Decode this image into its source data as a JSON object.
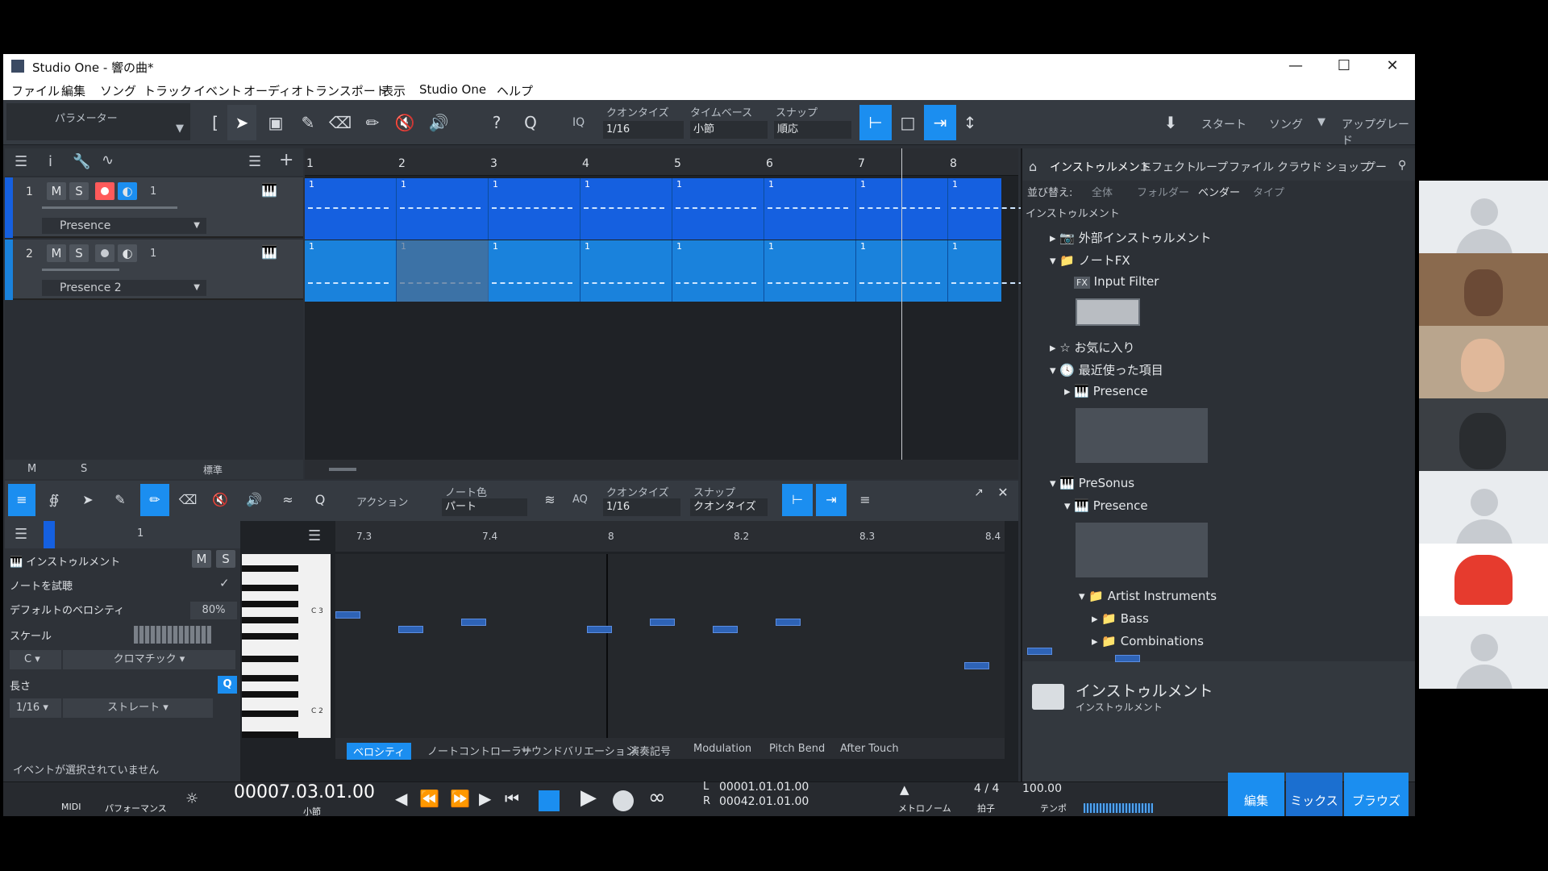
{
  "window": {
    "title": "Studio One - 響の曲*"
  },
  "menu": [
    "ファイル",
    "編集",
    "ソング",
    "トラック",
    "イベント",
    "オーディオ",
    "トランスポート",
    "表示",
    "Studio One",
    "ヘルプ"
  ],
  "toolbar": {
    "param_label": "パラメーター",
    "quantize_label": "クオンタイズ",
    "quantize_value": "1/16",
    "timebase_label": "タイムベース",
    "timebase_value": "小節",
    "snap_label": "スナップ",
    "snap_value": "順応",
    "iq": "IQ",
    "start": "スタート",
    "song": "ソング",
    "upgrade": "アップグレード"
  },
  "tracks": [
    {
      "num": "1",
      "m": "M",
      "s": "S",
      "ch": "1",
      "instrument": "Presence",
      "record_armed": true
    },
    {
      "num": "2",
      "m": "M",
      "s": "S",
      "ch": "1",
      "instrument": "Presence 2",
      "record_armed": false
    }
  ],
  "arrange": {
    "ruler": [
      "1",
      "2",
      "3",
      "4",
      "5",
      "6",
      "7",
      "8"
    ],
    "part_label": "1",
    "footer_m": "M",
    "footer_s": "S",
    "footer_mode": "標準"
  },
  "browser": {
    "tabs": [
      "インストゥルメント",
      "エフェクト",
      "ループ",
      "ファイル",
      "クラウド",
      "ショップ",
      "プー"
    ],
    "sort_label": "並び替え:",
    "sort_options": [
      "全体",
      "フォルダー",
      "ベンダー",
      "タイプ"
    ],
    "breadcrumb": "インストゥルメント",
    "items": [
      {
        "label": "外部インストゥルメント"
      },
      {
        "label": "ノートFX"
      },
      {
        "label": "Input Filter"
      },
      {
        "label": "お気に入り"
      },
      {
        "label": "最近使った項目"
      },
      {
        "label": "Presence"
      },
      {
        "label": "PreSonus"
      },
      {
        "label": "Presence"
      },
      {
        "label": "Artist Instruments"
      },
      {
        "label": "Bass"
      },
      {
        "label": "Combinations"
      }
    ],
    "fx_badge": "FX",
    "footer_title": "インストゥルメント",
    "footer_sub": "インストゥルメント"
  },
  "editor": {
    "action": "アクション",
    "note_color_label": "ノート色",
    "note_color_value": "パート",
    "aq": "AQ",
    "quantize_label": "クオンタイズ",
    "quantize_value": "1/16",
    "snap_label": "スナップ",
    "snap_value": "クオンタイズ",
    "track_num": "1",
    "ruler": [
      "7.3",
      "7.4",
      "8",
      "8.2",
      "8.3",
      "8.4"
    ],
    "rows": {
      "instrument": "インストゥルメント",
      "m": "M",
      "s": "S",
      "audition": "ノートを試聴",
      "velocity_label": "デフォルトのベロシティ",
      "velocity_value": "80%",
      "scale": "スケール",
      "key": "C",
      "scale_type": "クロマチック",
      "length": "長さ",
      "length_value": "1/16",
      "length_type": "ストレート"
    },
    "piano_labels": [
      "C 3",
      "C 2"
    ],
    "bottom_tabs": [
      "ベロシティ",
      "ノートコントローラー",
      "サウンドバリエーション",
      "演奏記号",
      "Modulation",
      "Pitch Bend",
      "After Touch"
    ],
    "status": "イベントが選択されていません",
    "notes": [
      {
        "pitch": 3,
        "start": 7.3,
        "len": 0.02
      },
      {
        "pitch": 5,
        "start": 7.35,
        "len": 0.02
      },
      {
        "pitch": 4,
        "start": 7.4,
        "len": 0.02
      },
      {
        "pitch": 5,
        "start": 8.0,
        "len": 0.02
      },
      {
        "pitch": 4,
        "start": 8.05,
        "len": 0.02
      },
      {
        "pitch": 5,
        "start": 8.1,
        "len": 0.02
      },
      {
        "pitch": 4,
        "start": 8.15,
        "len": 0.02
      },
      {
        "pitch": 8,
        "start": 8.35,
        "len": 0.02
      },
      {
        "pitch": 10,
        "start": 8.3,
        "len": 0.02
      },
      {
        "pitch": 9,
        "start": 8.42,
        "len": 0.02
      }
    ]
  },
  "transport": {
    "midi": "MIDI",
    "performance": "パフォーマンス",
    "position": "00007.03.01.00",
    "position_unit": "小節",
    "left": "00001.01.01.00",
    "right": "00042.01.01.00",
    "l": "L",
    "r": "R",
    "metronome": "メトロノーム",
    "signature": "4 / 4",
    "signature_label": "拍子",
    "tempo": "100.00",
    "tempo_label": "テンポ",
    "edit": "編集",
    "mix": "ミックス",
    "browse": "ブラウズ"
  },
  "colors": {
    "accent": "#1b8ef0",
    "track1": "#1560e0",
    "track2": "#1a82dc"
  }
}
